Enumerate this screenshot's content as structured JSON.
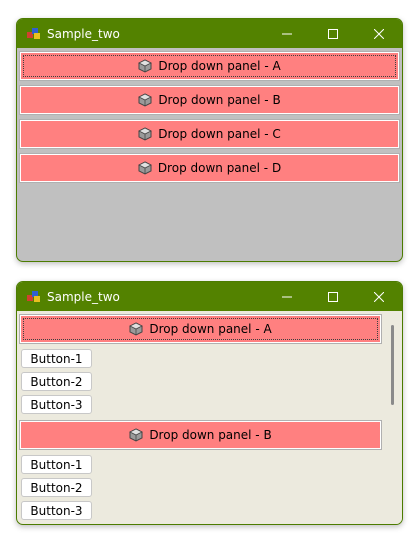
{
  "window_top": {
    "title": "Sample_two",
    "panels": [
      {
        "label": "Drop down panel - A"
      },
      {
        "label": "Drop down panel - B"
      },
      {
        "label": "Drop down panel - C"
      },
      {
        "label": "Drop down panel - D"
      }
    ]
  },
  "window_bottom": {
    "title": "Sample_two",
    "panel_a": {
      "label": "Drop down panel - A",
      "buttons": [
        "Button-1",
        "Button-2",
        "Button-3"
      ]
    },
    "panel_b": {
      "label": "Drop down panel - B",
      "buttons": [
        "Button-1",
        "Button-2",
        "Button-3"
      ]
    }
  },
  "icons": {
    "app": "app-icon",
    "panel": "cube-icon",
    "minimize": "minimize-icon",
    "maximize": "maximize-icon",
    "close": "close-icon"
  },
  "colors": {
    "titlebar": "#538200",
    "panel_header": "#ff8080",
    "empty_area": "#c0c0c0",
    "panel_body": "#eceade"
  }
}
